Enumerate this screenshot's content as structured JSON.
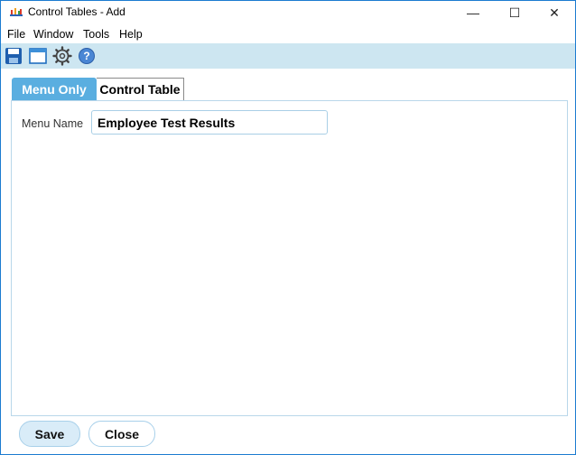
{
  "window": {
    "title": "Control Tables - Add",
    "controls": {
      "minimize": "—",
      "maximize": "☐",
      "close": "✕"
    }
  },
  "menubar": {
    "items": [
      {
        "label": "File"
      },
      {
        "label": "Window"
      },
      {
        "label": "Tools"
      },
      {
        "label": "Help"
      }
    ]
  },
  "toolbar": {
    "icons": [
      "save-icon",
      "window-icon",
      "settings-gear-icon",
      "help-icon"
    ]
  },
  "tabs": [
    {
      "label": "Menu Only",
      "active": true
    },
    {
      "label": "Control Table",
      "active": false
    }
  ],
  "form": {
    "menu_name_label": "Menu Name",
    "menu_name_value": "Employee Test Results"
  },
  "footer": {
    "save_label": "Save",
    "close_label": "Close"
  },
  "colors": {
    "accent": "#5aaee0",
    "toolbar_bg": "#cde6f1",
    "window_border": "#1b7bd0",
    "save_button_bg": "#d9ecf8"
  }
}
